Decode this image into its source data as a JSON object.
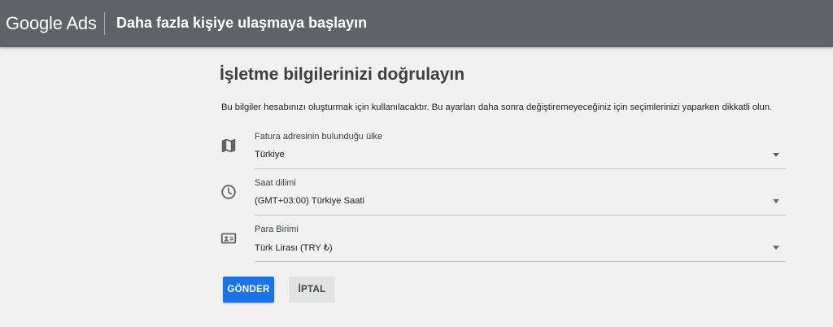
{
  "header": {
    "logo_text": "Google Ads",
    "title": "Daha fazla kişiye ulaşmaya başlayın"
  },
  "form": {
    "title": "İşletme bilgilerinizi doğrulayın",
    "intro": "Bu bilgiler hesabınızı oluşturmak için kullanılacaktır. Bu ayarları daha sonra değiştiremeyeceğiniz için seçimlerinizi yaparken dikkatli olun.",
    "fields": [
      {
        "icon": "map-icon",
        "label": "Fatura adresinin bulunduğu ülke",
        "value": "Türkiye"
      },
      {
        "icon": "clock-icon",
        "label": "Saat dilimi",
        "value": "(GMT+03:00) Türkiye Saati"
      },
      {
        "icon": "currency-icon",
        "label": "Para Birimi",
        "value": "Türk Lirası (TRY ₺)"
      }
    ],
    "submit_label": "GÖNDER",
    "cancel_label": "İPTAL"
  },
  "colors": {
    "topbar": "#5f6368",
    "background": "#f1f1f1",
    "primary": "#1a73e8",
    "secondary_button": "#e2e2e2"
  }
}
